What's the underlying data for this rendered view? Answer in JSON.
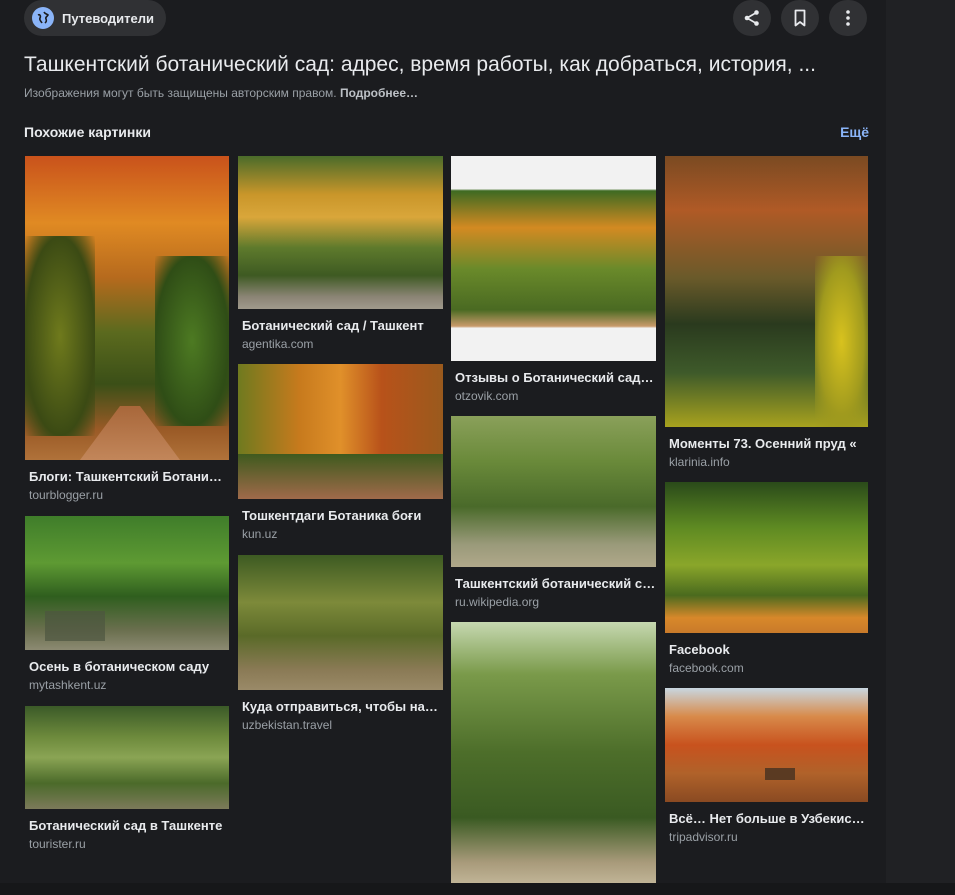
{
  "header": {
    "guides_label": "Путеводители",
    "title": "Ташкентский ботанический сад: адрес, время работы, как добраться, история, ...",
    "copyright_text": "Изображения могут быть защищены авторским правом.",
    "copyright_more": "Подробнее…"
  },
  "similar": {
    "section_title": "Похожие картинки",
    "more_label": "Ещё"
  },
  "cards": [
    {
      "caption": "Блоги: Ташкентский Ботанический сад",
      "source": "tourblogger.ru"
    },
    {
      "caption": "Осень в ботаническом саду",
      "source": "mytashkent.uz"
    },
    {
      "caption": "Ботанический сад в Ташкенте",
      "source": "tourister.ru"
    },
    {
      "caption": "Ботанический сад / Ташкент",
      "source": "agentika.com"
    },
    {
      "caption": "Тошкентдаги Ботаника боғи",
      "source": "kun.uz"
    },
    {
      "caption": "Куда отправиться, чтобы насладиться",
      "source": "uzbekistan.travel"
    },
    {
      "caption": "Отзывы о Ботанический сад (Ташкент)",
      "source": "otzovik.com"
    },
    {
      "caption": "Ташкентский ботанический сад",
      "source": "ru.wikipedia.org"
    },
    {
      "caption": "Моменты 73. Осенний пруд «",
      "source": "klarinia.info"
    },
    {
      "caption": "Facebook",
      "source": "facebook.com"
    },
    {
      "caption": "Всё… Нет больше в Узбекистане",
      "source": "tripadvisor.ru"
    }
  ]
}
